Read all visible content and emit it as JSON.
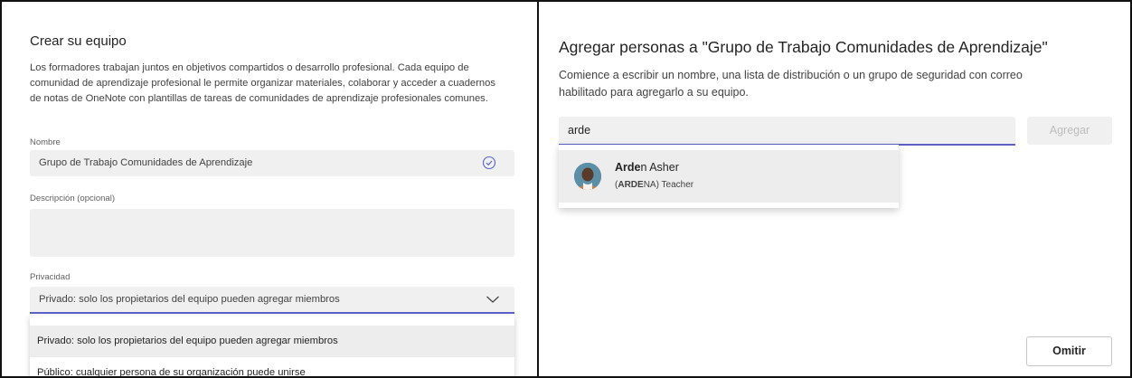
{
  "create_team": {
    "title": "Crear su equipo",
    "description": "Los formadores trabajan juntos en objetivos compartidos o desarrollo profesional. Cada equipo de comunidad de aprendizaje profesional le permite organizar materiales, colaborar y acceder a cuadernos de notas de OneNote con plantillas de tareas de comunidades de aprendizaje profesionales comunes.",
    "name_label": "Nombre",
    "name_value": "Grupo de Trabajo Comunidades de Aprendizaje",
    "description_label": "Descripción (opcional)",
    "description_value": "",
    "privacy_label": "Privacidad",
    "privacy_selected": "Privado: solo los propietarios del equipo pueden agregar miembros",
    "privacy_options": [
      "Privado: solo los propietarios del equipo pueden agregar miembros",
      "Público: cualquier persona de su organización puede unirse"
    ]
  },
  "add_people": {
    "title": "Agregar personas a \"Grupo de Trabajo Comunidades de Aprendizaje\"",
    "description": "Comience a escribir un nombre, una lista de distribución o un grupo de seguridad con correo habilitado para agregarlo a su equipo.",
    "search_value": "arde",
    "add_label": "Agregar",
    "skip_label": "Omitir",
    "suggestion": {
      "name_match": "Arde",
      "name_rest": "n Asher",
      "alias_open": "(",
      "alias_match": "ARDE",
      "alias_rest": "NA) Teacher"
    }
  },
  "colors": {
    "accent": "#5b5fc7",
    "input_bg": "#f0f0f0"
  }
}
